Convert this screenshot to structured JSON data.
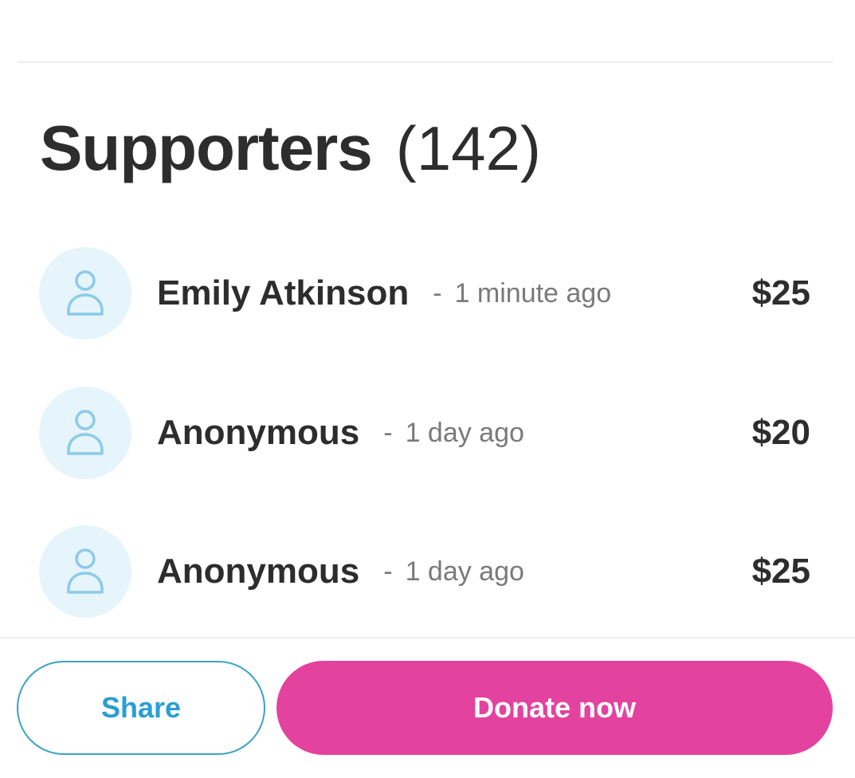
{
  "supporters": {
    "title": "Supporters",
    "count": "(142)",
    "items": [
      {
        "name": "Emily Atkinson",
        "separator": "-",
        "time": "1 minute ago",
        "amount": "$25",
        "icon": "person-icon"
      },
      {
        "name": "Anonymous",
        "separator": "-",
        "time": "1 day ago",
        "amount": "$20",
        "icon": "person-icon"
      },
      {
        "name": "Anonymous",
        "separator": "-",
        "time": "1 day ago",
        "amount": "$25",
        "icon": "person-icon"
      }
    ]
  },
  "actions": {
    "share_label": "Share",
    "donate_label": "Donate now"
  },
  "colors": {
    "accent_blue": "#2a9fd1",
    "donate_pink": "#e3429f",
    "avatar_bg": "#e6f4fb",
    "avatar_icon": "#8ccbe8"
  }
}
